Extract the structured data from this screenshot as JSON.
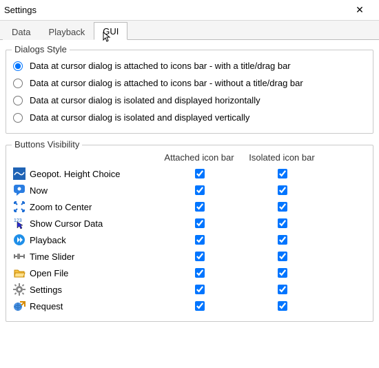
{
  "window": {
    "title": "Settings"
  },
  "tabs": {
    "items": [
      {
        "label": "Data"
      },
      {
        "label": "Playback"
      },
      {
        "label": "GUI"
      }
    ],
    "active_index": 2
  },
  "dialogs_style": {
    "legend": "Dialogs Style",
    "options": [
      {
        "label": "Data at cursor dialog is attached to icons bar - with a title/drag bar",
        "checked": true
      },
      {
        "label": "Data at cursor dialog is attached to icons bar - without a title/drag bar",
        "checked": false
      },
      {
        "label": "Data at cursor dialog is isolated and displayed horizontally",
        "checked": false
      },
      {
        "label": "Data at cursor dialog is isolated and displayed vertically",
        "checked": false
      }
    ]
  },
  "buttons_visibility": {
    "legend": "Buttons Visibility",
    "col1": "Attached icon bar",
    "col2": "Isolated icon bar",
    "rows": [
      {
        "label": "Geopot. Height Choice",
        "attached": true,
        "isolated": true
      },
      {
        "label": "Now",
        "attached": true,
        "isolated": true
      },
      {
        "label": "Zoom to Center",
        "attached": true,
        "isolated": true
      },
      {
        "label": "Show Cursor Data",
        "attached": true,
        "isolated": true
      },
      {
        "label": "Playback",
        "attached": true,
        "isolated": true
      },
      {
        "label": "Time Slider",
        "attached": true,
        "isolated": true
      },
      {
        "label": "Open File",
        "attached": true,
        "isolated": true
      },
      {
        "label": "Settings",
        "attached": true,
        "isolated": true
      },
      {
        "label": "Request",
        "attached": true,
        "isolated": true
      }
    ]
  }
}
